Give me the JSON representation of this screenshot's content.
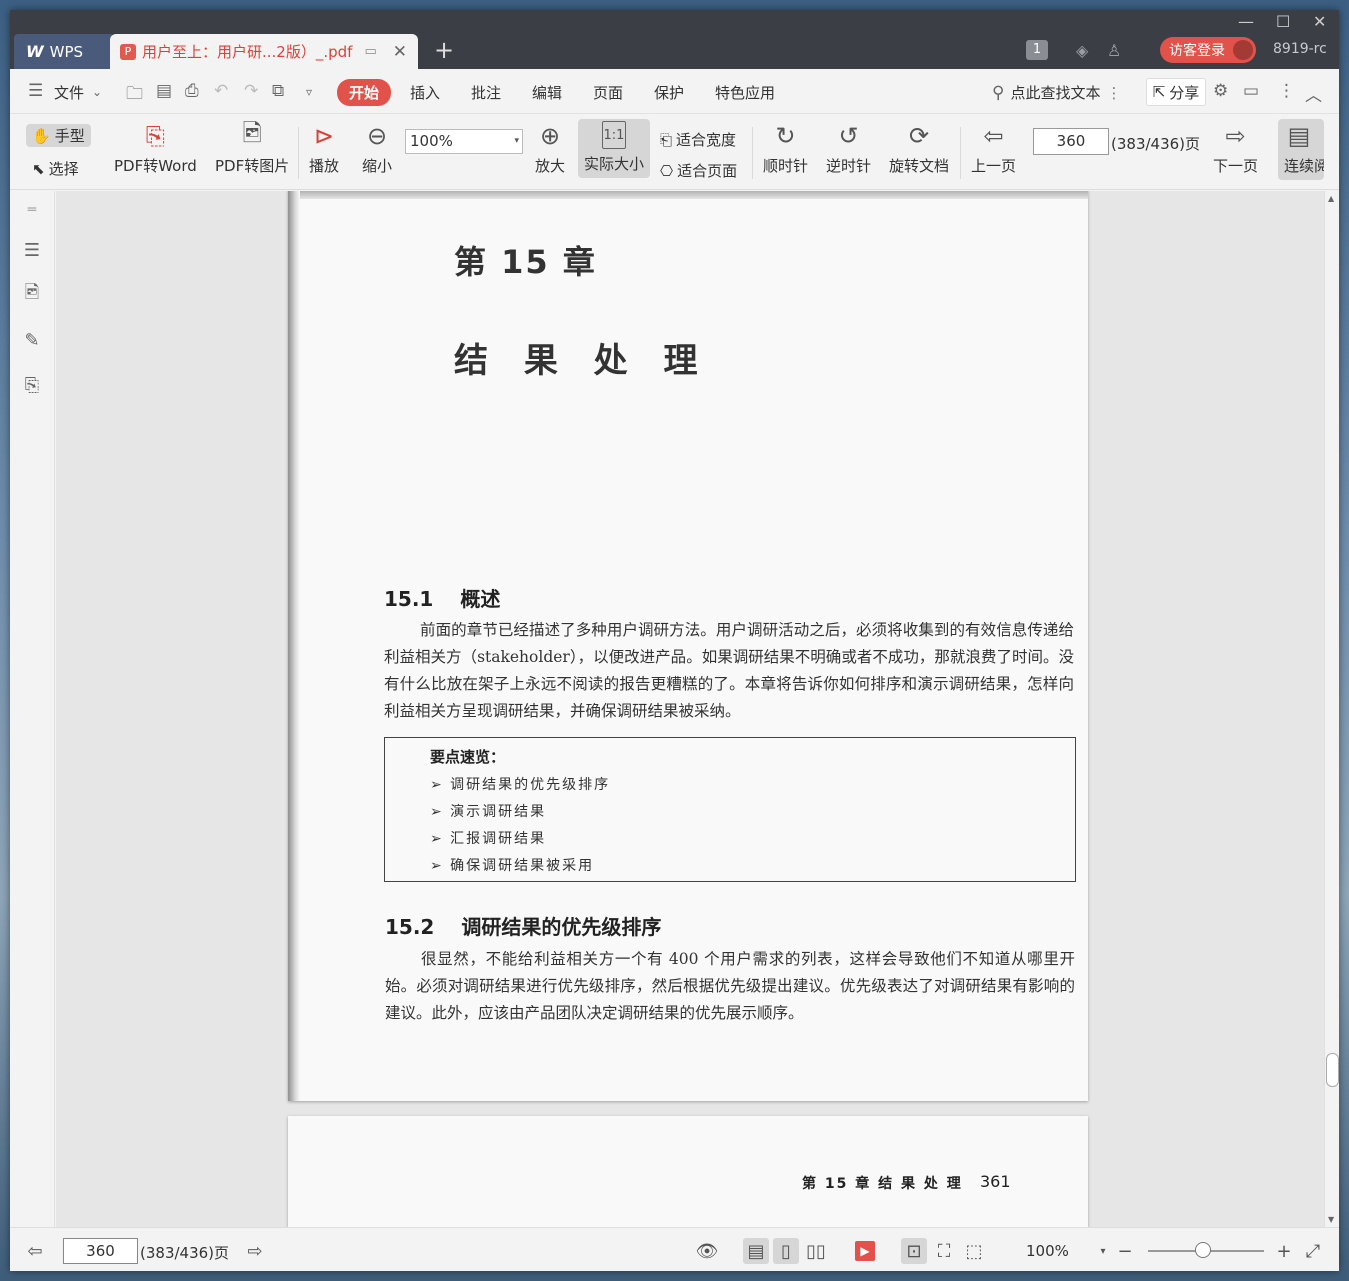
{
  "titlebar": {
    "app_tab": "WPS",
    "doc_tab_title": "用户至上：用户研...2版）_.pdf",
    "page_count_badge": "1",
    "login_label": "访客登录",
    "user_name": "8919-rc"
  },
  "menubar": {
    "file": "文件",
    "tabs": [
      "开始",
      "插入",
      "批注",
      "编辑",
      "页面",
      "保护",
      "特色应用"
    ],
    "search_placeholder": "点此查找文本",
    "share": "分享"
  },
  "toolbar": {
    "hand": "手型",
    "select": "选择",
    "pdf_to_word": "PDF转Word",
    "pdf_to_image": "PDF转图片",
    "play": "播放",
    "zoom_out": "缩小",
    "zoom_value": "100%",
    "zoom_in": "放大",
    "actual_size": "实际大小",
    "fit_width": "适合宽度",
    "fit_page": "适合页面",
    "rotate_cw": "顺时针",
    "rotate_ccw": "逆时针",
    "rotate_doc": "旋转文档",
    "prev_page": "上一页",
    "page_input": "360",
    "page_total": "(383/436)页",
    "next_page": "下一页",
    "continuous": "连续阅"
  },
  "document": {
    "chapter_no": "第 15 章",
    "chapter_title": "结 果 处 理",
    "section1_num": "15.1",
    "section1_title": "概述",
    "section1_para": "前面的章节已经描述了多种用户调研方法。用户调研活动之后，必须将收集到的有效信息传递给利益相关方（stakeholder），以便改进产品。如果调研结果不明确或者不成功，那就浪费了时间。没有什么比放在架子上永远不阅读的报告更糟糕的了。本章将告诉你如何排序和演示调研结果，怎样向利益相关方呈现调研结果，并确保调研结果被采纳。",
    "keypoints_title": "要点速览：",
    "keypoints": [
      "➢ 调研结果的优先级排序",
      "➢ 演示调研结果",
      "➢ 汇报调研结果",
      "➢ 确保调研结果被采用"
    ],
    "section2_num": "15.2",
    "section2_title": "调研结果的优先级排序",
    "section2_para": "很显然，不能给利益相关方一个有 400 个用户需求的列表，这样会导致他们不知道从哪里开始。必须对调研结果进行优先级排序，然后根据优先级提出建议。优先级表达了对调研结果有影响的建议。此外，应该由产品团队决定调研结果的优先展示顺序。",
    "next_page_header": "第 15 章   结 果 处 理",
    "next_page_number": "361"
  },
  "statusbar": {
    "page_input": "360",
    "page_total": "(383/436)页",
    "zoom": "100%"
  },
  "colors": {
    "accent": "#e0524a",
    "titlebar": "#3b3e45"
  }
}
